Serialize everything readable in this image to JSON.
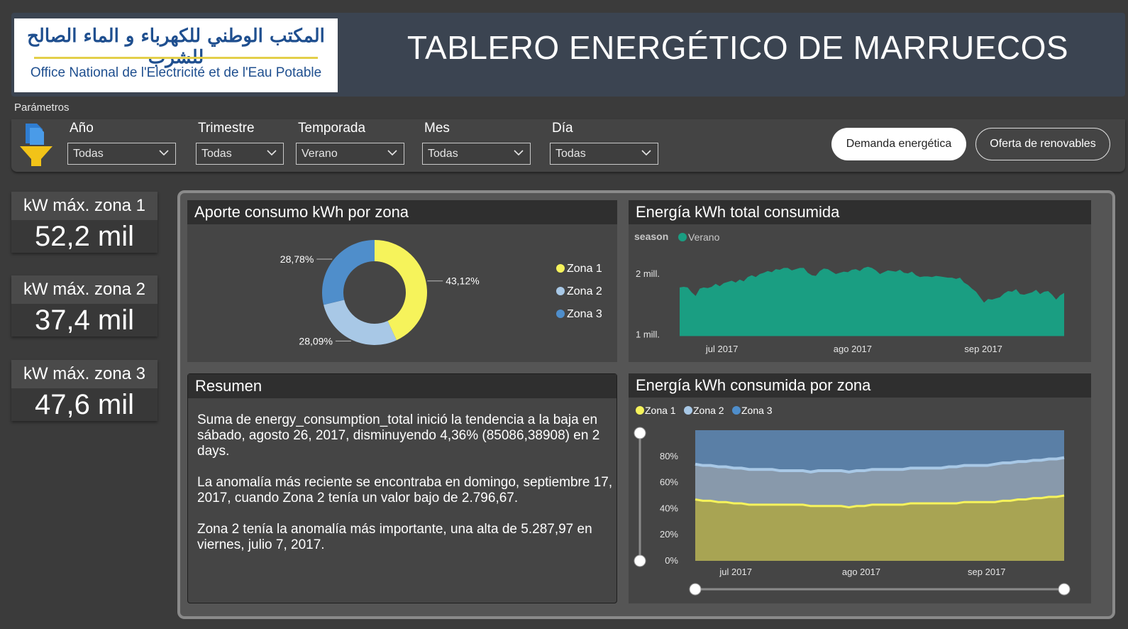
{
  "header": {
    "logo_arabic": "المكتب الوطني للكهرباء و الماء الصالح للشرب",
    "logo_french": "Office National de l'Electricité et de l'Eau Potable",
    "title": "TABLERO ENERGÉTICO DE MARRUECOS"
  },
  "parameters": {
    "label": "Parámetros",
    "slicers": [
      {
        "label": "Año",
        "value": "Todas"
      },
      {
        "label": "Trimestre",
        "value": "Todas"
      },
      {
        "label": "Temporada",
        "value": "Verano"
      },
      {
        "label": "Mes",
        "value": "Todas"
      },
      {
        "label": "Día",
        "value": "Todas"
      }
    ],
    "buttons": {
      "demand": "Demanda energética",
      "renewables": "Oferta de renovables"
    }
  },
  "kpis": [
    {
      "label": "kW máx. zona 1",
      "value": "52,2 mil"
    },
    {
      "label": "kW máx. zona 2",
      "value": "37,4 mil"
    },
    {
      "label": "kW máx. zona 3",
      "value": "47,6 mil"
    }
  ],
  "colors": {
    "zona1": "#f6f35b",
    "zona2": "#a8c8e6",
    "zona3": "#4f8ecb",
    "verano": "#1a9e82"
  },
  "summary": {
    "title": "Resumen",
    "paragraphs": [
      "Suma de energy_consumption_total inició la tendencia a la baja en sábado, agosto 26, 2017, disminuyendo 4,36% (85086,38908) en 2 days.",
      "La anomalía más reciente se encontraba en domingo, septiembre 17, 2017, cuando Zona 2 tenía un valor bajo de 2.796,67.",
      "Zona 2 tenía la anomalía más importante, una alta de 5.287,97 en viernes, julio 7, 2017."
    ]
  },
  "chart_data": [
    {
      "type": "pie",
      "title": "Aporte consumo kWh por zona",
      "categories": [
        "Zona 1",
        "Zona 2",
        "Zona 3"
      ],
      "values": [
        43.12,
        28.09,
        28.78
      ],
      "data_labels": [
        "43,12%",
        "28,09%",
        "28,78%"
      ],
      "legend": "right"
    },
    {
      "type": "area",
      "title": "Energía kWh total consumida",
      "legend_title": "season",
      "series": [
        {
          "name": "Verano",
          "values": [
            1.78,
            1.79,
            1.78,
            1.7,
            1.64,
            1.76,
            1.78,
            1.77,
            1.79,
            1.84,
            1.8,
            1.85,
            1.87,
            1.89,
            1.86,
            1.91,
            1.88,
            1.95,
            1.98,
            1.95,
            2.0,
            2.02,
            2.05,
            2.03,
            2.08,
            2.07,
            2.1,
            2.1,
            2.06,
            2.08,
            2.1,
            2.1,
            2.02,
            1.98,
            1.97,
            2.05,
            2.09,
            2.08,
            2.04,
            2.0,
            2.02,
            2.04,
            2.03,
            2.07,
            2.08,
            2.05,
            2.1,
            2.12,
            2.1,
            2.06,
            2.0,
            2.03,
            2.06,
            2.05,
            2.04,
            2.07,
            2.02,
            2.01,
            2.04,
            1.98,
            1.95,
            1.96,
            1.96,
            1.95,
            1.97,
            1.96,
            1.95,
            1.94,
            1.94,
            1.92,
            1.94,
            1.86,
            1.82,
            1.76,
            1.71,
            1.62,
            1.53,
            1.59,
            1.58,
            1.6,
            1.62,
            1.68,
            1.72,
            1.71,
            1.75,
            1.67,
            1.66,
            1.68,
            1.7,
            1.74,
            1.67,
            1.71,
            1.72,
            1.66,
            1.58,
            1.65,
            1.69
          ]
        }
      ],
      "x_ticks": [
        "jul 2017",
        "ago 2017",
        "sep 2017"
      ],
      "y_ticks": [
        "1 mill.",
        "2 mill."
      ],
      "ylim": [
        0.95,
        2.35
      ]
    },
    {
      "type": "area",
      "title": "Energía kWh consumida por zona",
      "stacked_percent": true,
      "categories_legend": [
        "Zona 1",
        "Zona 2",
        "Zona 3"
      ],
      "series": [
        {
          "name": "Zona 1",
          "values": [
            47,
            46,
            46,
            45,
            45,
            44,
            44,
            43,
            43,
            43,
            43,
            43,
            43,
            43,
            43,
            42,
            42,
            42,
            42,
            42,
            41,
            42,
            42,
            43,
            43,
            43,
            43,
            43,
            44,
            44,
            44,
            44,
            44,
            44,
            44,
            45,
            45,
            45,
            45,
            45,
            46,
            46,
            47,
            47,
            48,
            48,
            49,
            49,
            50
          ]
        },
        {
          "name": "Zona 2",
          "values": [
            27,
            27,
            27,
            27,
            27,
            27,
            27,
            27,
            27,
            27,
            27,
            26,
            26,
            26,
            26,
            26,
            27,
            27,
            27,
            27,
            27,
            27,
            27,
            27,
            27,
            27,
            27,
            27,
            27,
            27,
            27,
            27,
            27,
            28,
            28,
            28,
            28,
            28,
            28,
            29,
            29,
            29,
            29,
            29,
            29,
            29,
            29,
            29,
            29
          ]
        },
        {
          "name": "Zona 3",
          "values": [
            26,
            27,
            27,
            28,
            28,
            29,
            29,
            30,
            30,
            30,
            30,
            31,
            31,
            31,
            31,
            32,
            31,
            31,
            31,
            31,
            32,
            31,
            31,
            30,
            30,
            30,
            30,
            30,
            29,
            29,
            29,
            29,
            29,
            28,
            28,
            27,
            27,
            27,
            27,
            26,
            25,
            25,
            24,
            24,
            23,
            23,
            22,
            22,
            21
          ]
        }
      ],
      "x_ticks": [
        "jul 2017",
        "ago 2017",
        "sep 2017"
      ],
      "y_ticks": [
        "0%",
        "20%",
        "40%",
        "60%",
        "80%"
      ],
      "ylim": [
        0,
        100
      ]
    }
  ]
}
